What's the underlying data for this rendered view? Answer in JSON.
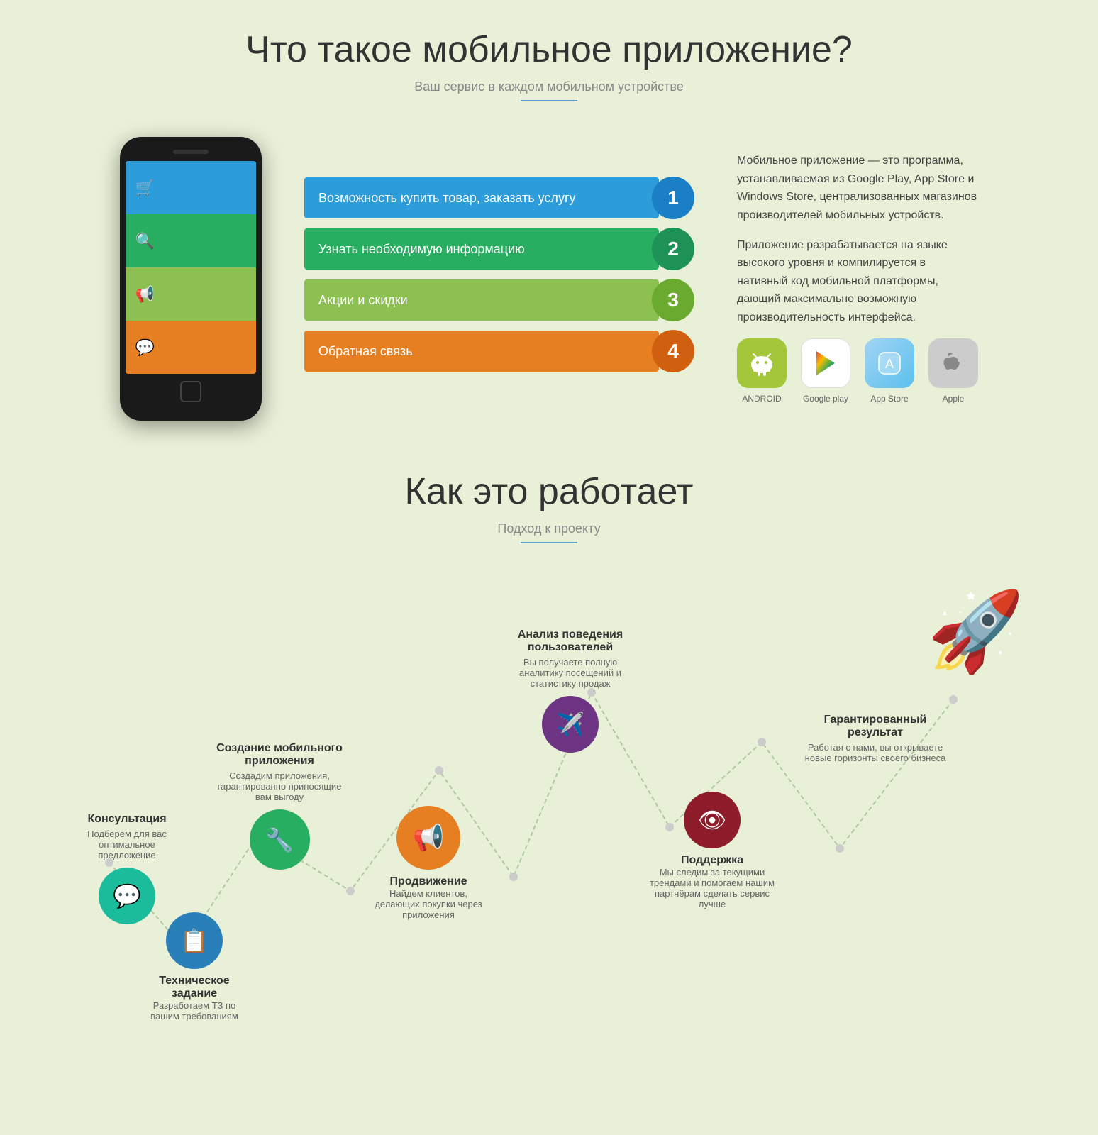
{
  "page": {
    "section1": {
      "title": "Что такое мобильное приложение?",
      "subtitle": "Ваш сервис в каждом мобильном устройстве",
      "menu_items": [
        {
          "id": 1,
          "text": "Возможность купить товар, заказать услугу",
          "color": "blue",
          "numClass": "num1"
        },
        {
          "id": 2,
          "text": "Узнать необходимую информацию",
          "color": "green",
          "numClass": "num2"
        },
        {
          "id": 3,
          "text": "Акции и скидки",
          "color": "lime",
          "numClass": "num3"
        },
        {
          "id": 4,
          "text": "Обратная связь",
          "color": "orange",
          "numClass": "num4"
        }
      ],
      "description1": "Мобильное приложение — это программа, устанавливаемая из Google Play, App Store и Windows Store, централизованных магазинов производителей мобильных устройств.",
      "description2": "Приложение разрабатывается на языке высокого уровня и компилируется в нативный код мобильной платформы, дающий максимально возможную производительность интерфейса.",
      "stores": [
        {
          "name": "Android",
          "icon": "🤖"
        },
        {
          "name": "Google play",
          "icon": "▶"
        },
        {
          "name": "App Store",
          "icon": "🅐"
        },
        {
          "name": "Apple",
          "icon": "🍎"
        }
      ]
    },
    "section2": {
      "title": "Как это работает",
      "subtitle": "Подход к проекту",
      "steps": [
        {
          "id": 1,
          "title": "Консультация",
          "desc": "Подберем для вас оптимальное предложение",
          "icon": "💬"
        },
        {
          "id": 2,
          "title": "Техническое задание",
          "desc": "Разработаем ТЗ по вашим требованиям",
          "icon": "📋"
        },
        {
          "id": 3,
          "title": "Создание мобильного приложения",
          "desc": "Создадим приложения, гарантированно приносящие вам выгоду",
          "icon": "🔧"
        },
        {
          "id": 4,
          "title": "Продвижение",
          "desc": "Найдем клиентов, делающих покупки через приложения",
          "icon": "📢"
        },
        {
          "id": 5,
          "title": "Анализ поведения пользователей",
          "desc": "Вы получаете полную аналитику посещений и статистику продаж",
          "icon": "✈"
        },
        {
          "id": 6,
          "title": "Поддержка",
          "desc": "Мы следим за текущими трендами и помогаем нашим партнёрам сделать сервис лучше",
          "icon": "👁"
        },
        {
          "id": 7,
          "title": "Гарантированный результат",
          "desc": "Работая с нами, вы открываете новые горизонты своего бизнеса",
          "icon": "🚀"
        }
      ]
    }
  }
}
